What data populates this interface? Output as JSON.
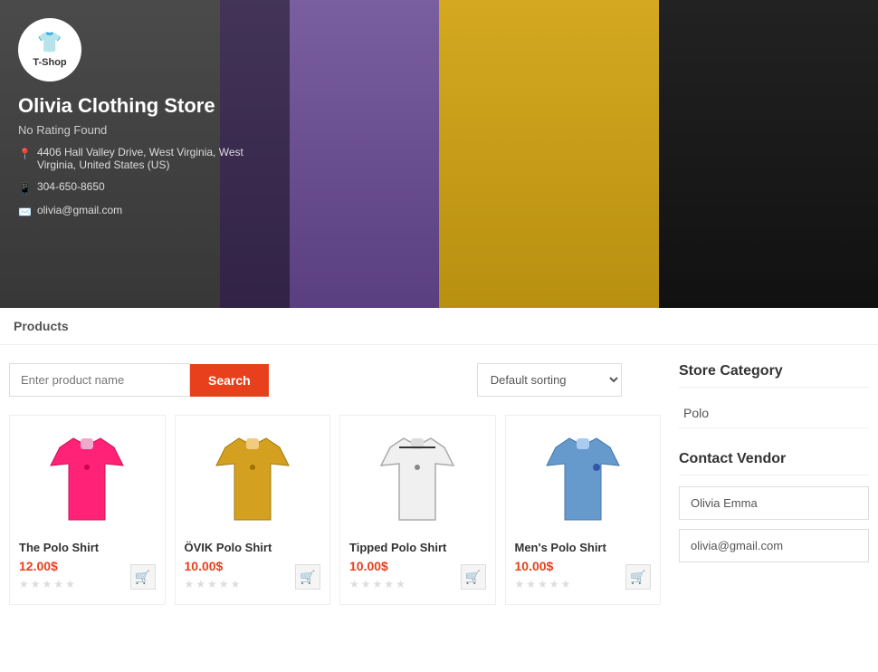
{
  "store": {
    "name": "Olivia Clothing Store",
    "rating": "No Rating Found",
    "address": "4406 Hall Valley Drive, West Virginia, West Virginia, United States (US)",
    "phone": "304-650-8650",
    "email": "olivia@gmail.com",
    "logo_text": "T-Shop",
    "logo_icon": "👕"
  },
  "products_section": {
    "label": "Products"
  },
  "search": {
    "placeholder": "Enter product name",
    "button_label": "Search"
  },
  "sort": {
    "default_label": "Default sorting"
  },
  "products": [
    {
      "name": "The Polo Shirt",
      "price": "12.00$",
      "color": "pink",
      "stars": 0,
      "id": "product-1"
    },
    {
      "name": "ÖVIK Polo Shirt",
      "price": "10.00$",
      "color": "yellow",
      "stars": 0,
      "id": "product-2"
    },
    {
      "name": "Tipped Polo Shirt",
      "price": "10.00$",
      "color": "white",
      "stars": 0,
      "id": "product-3"
    },
    {
      "name": "Men's Polo Shirt",
      "price": "10.00$",
      "color": "blue",
      "stars": 0,
      "id": "product-4"
    }
  ],
  "sidebar": {
    "category_title": "Store Category",
    "category_items": [
      "Polo"
    ],
    "vendor_title": "Contact Vendor",
    "vendor_name_placeholder": "Olivia Emma",
    "vendor_email_placeholder": "olivia@gmail.com"
  },
  "colors": {
    "accent": "#e8401c",
    "star_empty": "#ddd",
    "text_dark": "#333",
    "text_muted": "#555"
  }
}
